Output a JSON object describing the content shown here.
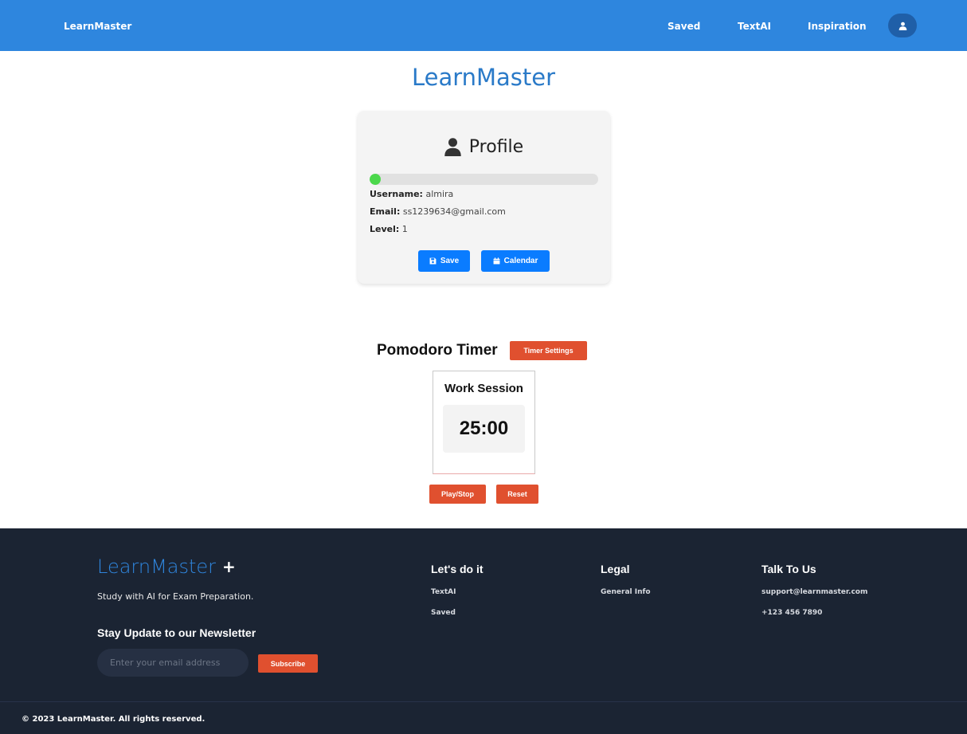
{
  "navbar": {
    "brand": "LearnMaster",
    "links": [
      "Saved",
      "TextAI",
      "Inspiration"
    ],
    "avatar_icon": "user-icon",
    "bg_color": "#2e86de"
  },
  "main": {
    "title": "LearnMaster",
    "title_color": "#2a7ac8"
  },
  "profile": {
    "title": "Profile",
    "icon": "user-icon",
    "progress_percent": 5,
    "progress_color": "#4cd84c",
    "username_label": "Username:",
    "username_value": "almira",
    "email_label": "Email:",
    "email_value": "ss1239634@gmail.com",
    "level_label": "Level:",
    "level_value": "1",
    "save_label": "Save",
    "save_icon": "floppy-disk-icon",
    "calendar_label": "Calendar",
    "calendar_icon": "calendar-icon",
    "button_color": "#0a7cff"
  },
  "pomodoro": {
    "title": "Pomodoro Timer",
    "settings_label": "Timer Settings",
    "session_label": "Work Session",
    "time": "25:00",
    "play_stop_label": "Play/Stop",
    "reset_label": "Reset",
    "button_color": "#e0502f"
  },
  "footer": {
    "logo_text": "LearnMaster",
    "logo_plus": "+",
    "tagline": "Study with AI for Exam Preparation.",
    "newsletter_title": "Stay Update to our Newsletter",
    "email_placeholder": "Enter your email address",
    "subscribe_label": "Subscribe",
    "columns": [
      {
        "title": "Let's do it",
        "links": [
          "TextAI",
          "Saved"
        ]
      },
      {
        "title": "Legal",
        "links": [
          "General Info"
        ]
      },
      {
        "title": "Talk To Us",
        "links": [
          "support@learnmaster.com",
          "+123 456 7890"
        ]
      }
    ],
    "copyright": "© 2023 LearnMaster. All rights reserved.",
    "bg_color": "#1b2433"
  }
}
